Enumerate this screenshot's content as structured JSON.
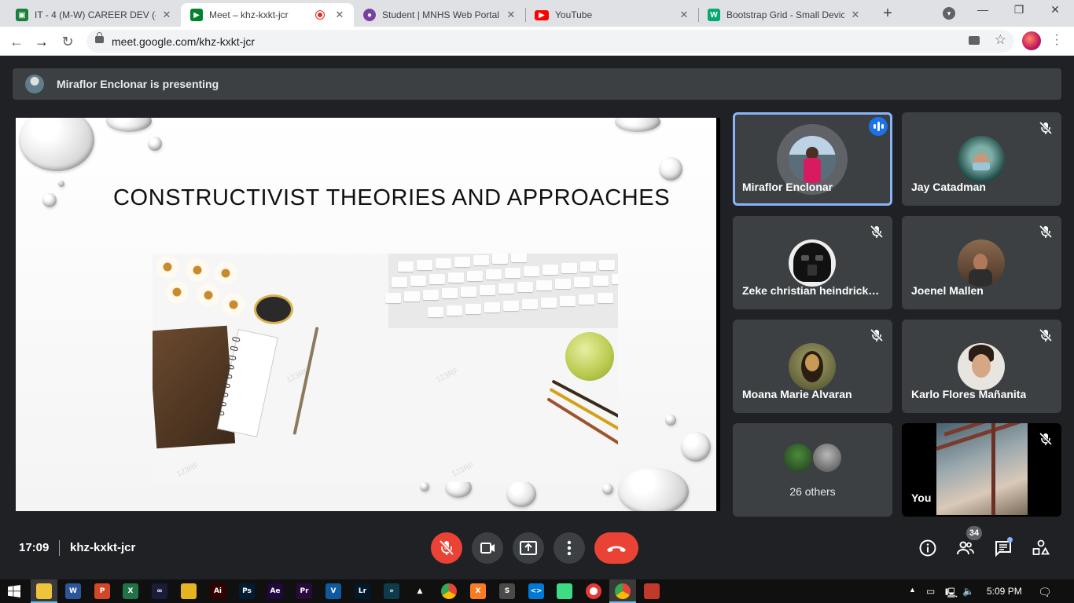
{
  "browser": {
    "tabs": [
      {
        "title": "IT - 4 (M-W) CAREER DEV (4(",
        "favicon": "classroom-icon",
        "color": "#188038"
      },
      {
        "title": "Meet – khz-kxkt-jcr",
        "favicon": "meet-icon",
        "color": "#00832d",
        "active": true,
        "recording": true
      },
      {
        "title": "Student | MNHS Web Portal",
        "favicon": "school-seal-icon",
        "color": "#7b3fa0"
      },
      {
        "title": "YouTube",
        "favicon": "youtube-icon",
        "color": "#ff0000"
      },
      {
        "title": "Bootstrap Grid - Small Device",
        "favicon": "w3schools-icon",
        "color": "#04aa6d"
      }
    ],
    "url": "meet.google.com/khz-kxkt-jcr"
  },
  "meet": {
    "presenting_text": "Miraflor Enclonar is presenting",
    "slide": {
      "title": "CONSTRUCTIVIST THEORIES AND APPROACHES"
    },
    "participants": [
      {
        "name": "Miraflor Enclonar",
        "speaking": true,
        "muted": false
      },
      {
        "name": "Jay Catadman",
        "muted": true
      },
      {
        "name": "Zeke christian heindrick …",
        "muted": true
      },
      {
        "name": "Joenel Mallen",
        "muted": true
      },
      {
        "name": "Moana Marie Alvaran",
        "muted": true
      },
      {
        "name": "Karlo Flores Mañanita",
        "muted": true
      }
    ],
    "others_label": "26 others",
    "self_label": "You",
    "bottom": {
      "time": "17:09",
      "meeting_code": "khz-kxkt-jcr",
      "people_count": "34"
    }
  },
  "taskbar": {
    "apps": [
      {
        "name": "file-explorer-icon",
        "label": "",
        "color": "#f0c33c"
      },
      {
        "name": "word-icon",
        "label": "W",
        "color": "#2b579a"
      },
      {
        "name": "powerpoint-icon",
        "label": "P",
        "color": "#d24726"
      },
      {
        "name": "excel-icon",
        "label": "X",
        "color": "#217346"
      },
      {
        "name": "infinity-app-icon",
        "label": "∞",
        "color": "#1b1b3a"
      },
      {
        "name": "paint-app-icon",
        "label": "",
        "color": "#e6b422"
      },
      {
        "name": "illustrator-icon",
        "label": "Ai",
        "color": "#330000"
      },
      {
        "name": "photoshop-icon",
        "label": "Ps",
        "color": "#001d34"
      },
      {
        "name": "after-effects-icon",
        "label": "Ae",
        "color": "#1f0740"
      },
      {
        "name": "premiere-icon",
        "label": "Pr",
        "color": "#2a0a3d"
      },
      {
        "name": "visual-studio-icon",
        "label": "V",
        "color": "#0e5a9e"
      },
      {
        "name": "lightroom-icon",
        "label": "Lr",
        "color": "#001a2c"
      },
      {
        "name": "media-app-icon",
        "label": "»",
        "color": "#0d3b4a"
      },
      {
        "name": "vlc-icon",
        "label": "▲",
        "color": "#101010"
      },
      {
        "name": "chrome-icon",
        "label": "",
        "color": "#4285f4"
      },
      {
        "name": "xampp-icon",
        "label": "X",
        "color": "#fb7a24"
      },
      {
        "name": "sublime-icon",
        "label": "S",
        "color": "#4a4a4a"
      },
      {
        "name": "vscode-icon",
        "label": "<>",
        "color": "#0078d4"
      },
      {
        "name": "android-icon",
        "label": "",
        "color": "#3ddc84"
      },
      {
        "name": "record-icon",
        "label": "",
        "color": "#e53935"
      },
      {
        "name": "chrome-active-icon",
        "label": "",
        "color": "#4285f4"
      },
      {
        "name": "xampp-panel-icon",
        "label": "",
        "color": "#c0392b"
      }
    ],
    "time": "5:09 PM"
  }
}
